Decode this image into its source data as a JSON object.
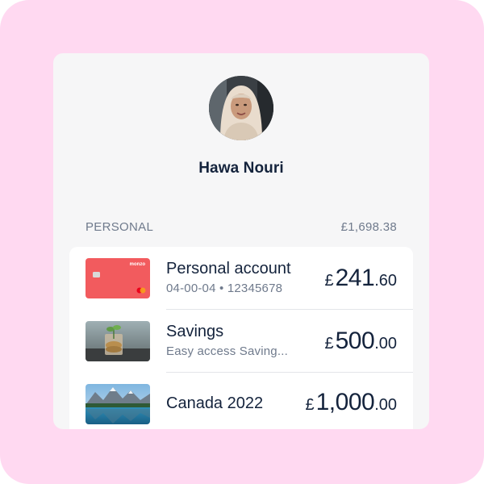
{
  "profile": {
    "name": "Hawa Nouri"
  },
  "section": {
    "label": "PERSONAL",
    "total": "£1,698.38"
  },
  "accounts": [
    {
      "title": "Personal account",
      "subtitle": "04-00-04 • 12345678",
      "currency": "£",
      "major": "241",
      "minor": ".60",
      "card_brand": "monzo",
      "card_color": "#f25b5e"
    },
    {
      "title": "Savings",
      "subtitle": "Easy access Saving...",
      "currency": "£",
      "major": "500",
      "minor": ".00"
    },
    {
      "title": "Canada 2022",
      "subtitle": "",
      "currency": "£",
      "major": "1,000",
      "minor": ".00"
    }
  ],
  "colors": {
    "background": "#ffd9f1",
    "panel": "#f6f6f7",
    "text": "#14233c",
    "muted": "#6f7a8c"
  }
}
